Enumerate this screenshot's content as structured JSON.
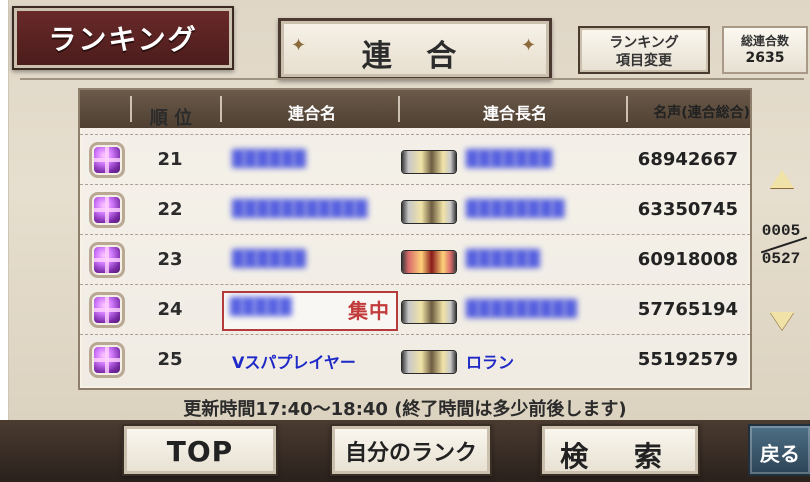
{
  "header": {
    "title": "ランキング",
    "current_tab": "連 合",
    "change_button": {
      "line1": "ランキング",
      "line2": "項目変更"
    },
    "total_label": "総連合数",
    "total_value": "2635"
  },
  "table": {
    "columns": [
      "順 位",
      "連合名",
      "連合長名",
      "名声(連合総合)"
    ],
    "rows": [
      {
        "rank": "21",
        "alliance_name": "",
        "leader_name": "",
        "fame": "68942667",
        "highlight": "",
        "icon": "gift-box",
        "weapon": "sword"
      },
      {
        "rank": "22",
        "alliance_name": "",
        "leader_name": "",
        "fame": "63350745",
        "highlight": "",
        "icon": "gift-box",
        "weapon": "sword"
      },
      {
        "rank": "23",
        "alliance_name": "",
        "leader_name": "",
        "fame": "60918008",
        "highlight": "",
        "icon": "gift-box",
        "weapon": "sword-red"
      },
      {
        "rank": "24",
        "alliance_name": "",
        "leader_name": "",
        "fame": "57765194",
        "highlight": "集中",
        "icon": "gift-box",
        "weapon": "sword"
      },
      {
        "rank": "25",
        "alliance_name": "Vスパプレイヤー",
        "leader_name": "ロラン",
        "fame": "55192579",
        "highlight": "",
        "icon": "gift-box",
        "weapon": "sword"
      }
    ]
  },
  "pager": {
    "current": "0005",
    "total": "0527"
  },
  "footer": {
    "update_time_text": "更新時間17:40〜18:40 (終了時間は多少前後します)",
    "buttons": {
      "top": "TOP",
      "my_rank": "自分のランク",
      "search": "検 索",
      "back": "戻る"
    }
  },
  "colors": {
    "alliance_text": "#1d28c7",
    "header_bar": "#4f4033",
    "title_plate": "#4a1b1b"
  }
}
